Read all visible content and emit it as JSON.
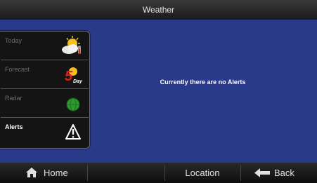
{
  "header": {
    "title": "Weather"
  },
  "sidebar": {
    "items": [
      {
        "label": "Today",
        "icon": "partly-cloudy-icon",
        "active": false
      },
      {
        "label": "Forecast",
        "icon": "five-day-icon",
        "icon_text": "5",
        "icon_subtext": "Day",
        "active": false
      },
      {
        "label": "Radar",
        "icon": "radar-globe-icon",
        "active": false
      },
      {
        "label": "Alerts",
        "icon": "warning-icon",
        "active": true
      }
    ]
  },
  "main": {
    "message": "Currently there are no Alerts"
  },
  "footer": {
    "home_label": "Home",
    "location_label": "Location",
    "back_label": "Back"
  },
  "colors": {
    "background": "#2a3a8a",
    "bar": "#1a1a1a",
    "panel": "#141414"
  }
}
